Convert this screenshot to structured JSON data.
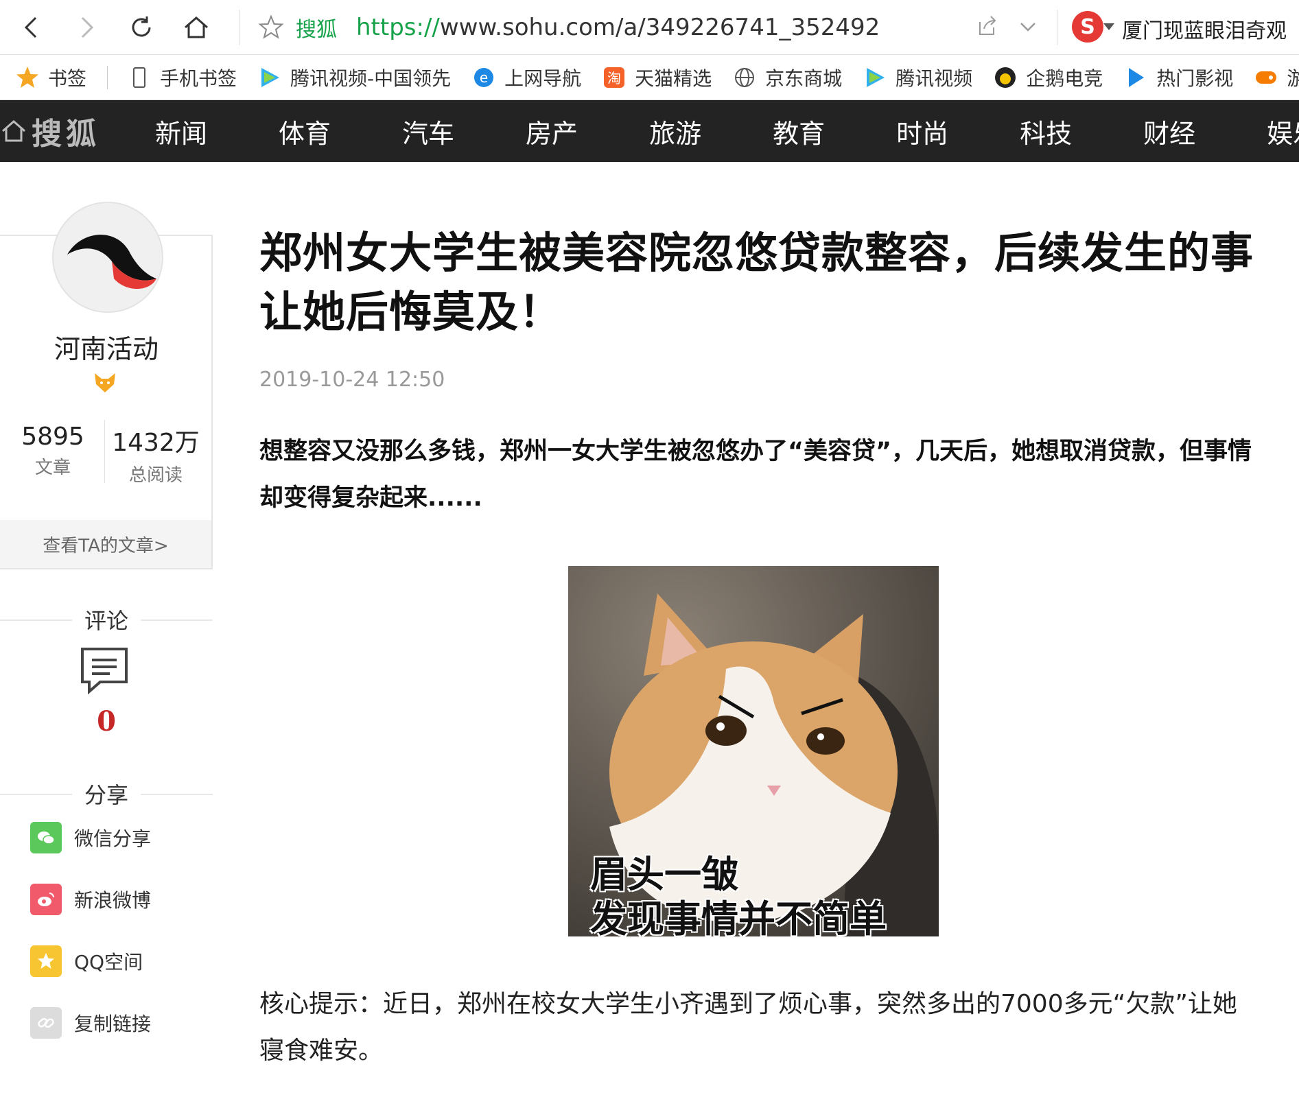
{
  "browser": {
    "site_name": "搜狐",
    "url_scheme": "https://",
    "url_rest": "www.sohu.com/a/349226741_352492",
    "search_suggestion": "厦门现蓝眼泪奇观"
  },
  "bookmarks": [
    {
      "label": "书签",
      "icon": "star-icon"
    },
    {
      "label": "手机书签",
      "icon": "phone-icon"
    },
    {
      "label": "腾讯视频-中国领先",
      "icon": "tencent-video-icon"
    },
    {
      "label": "上网导航",
      "icon": "ie-icon"
    },
    {
      "label": "天猫精选",
      "icon": "taobao-icon"
    },
    {
      "label": "京东商城",
      "icon": "globe-icon"
    },
    {
      "label": "腾讯视频",
      "icon": "tencent-video-icon"
    },
    {
      "label": "企鹅电竞",
      "icon": "penguin-esports-icon"
    },
    {
      "label": "热门影视",
      "icon": "play-icon"
    },
    {
      "label": "游戏中心",
      "icon": "gamepad-icon"
    }
  ],
  "sohu_nav": {
    "logo_text": "搜狐",
    "items": [
      "新闻",
      "体育",
      "汽车",
      "房产",
      "旅游",
      "教育",
      "时尚",
      "科技",
      "财经",
      "娱乐"
    ]
  },
  "author": {
    "name": "河南活动",
    "articles_count": "5895",
    "articles_label": "文章",
    "reads_count": "1432万",
    "reads_label": "总阅读",
    "view_link": "查看TA的文章>"
  },
  "comments": {
    "title": "评论",
    "count": "0"
  },
  "share": {
    "title": "分享",
    "items": [
      {
        "label": "微信分享",
        "icon": "wechat-icon",
        "color": "#5ac85a"
      },
      {
        "label": "新浪微博",
        "icon": "weibo-icon",
        "color": "#f05a6a"
      },
      {
        "label": "QQ空间",
        "icon": "qzone-icon",
        "color": "#f7c531"
      },
      {
        "label": "复制链接",
        "icon": "link-icon",
        "color": "#dcdcdc"
      }
    ]
  },
  "article": {
    "title": "郑州女大学生被美容院忽悠贷款整容，后续发生的事让她后悔莫及！",
    "date": "2019-10-24 12:50",
    "lead": "想整容又没那么多钱，郑州一女大学生被忽悠办了“美容贷”，几天后，她想取消贷款，但事情却变得复杂起来......",
    "image_caption_line1": "眉头一皱",
    "image_caption_line2": "发现事情并不简单",
    "body_paragraph": "核心提示：近日，郑州在校女大学生小齐遇到了烦心事，突然多出的7000多元“欠款”让她寝食难安。"
  }
}
